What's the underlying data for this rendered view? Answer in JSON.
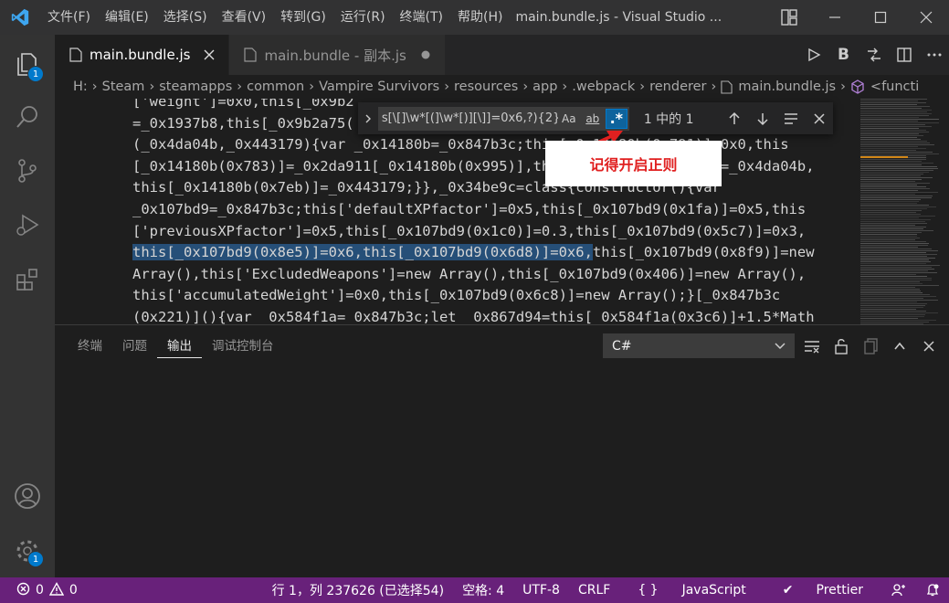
{
  "app": {
    "window_title": "main.bundle.js - Visual Studio ...",
    "menu": [
      "文件(F)",
      "编辑(E)",
      "选择(S)",
      "查看(V)",
      "转到(G)",
      "运行(R)",
      "终端(T)",
      "帮助(H)"
    ]
  },
  "activity": {
    "explorer_badge": "1",
    "settings_badge": "1"
  },
  "tabs": [
    {
      "label": "main.bundle.js",
      "active": true
    },
    {
      "label": "main.bundle - 副本.js",
      "active": false
    }
  ],
  "editor_actions": {
    "run": "▷",
    "b": "B"
  },
  "breadcrumb": [
    "H:",
    "Steam",
    "steamapps",
    "common",
    "Vampire Survivors",
    "resources",
    "app",
    ".webpack",
    "renderer",
    "main.bundle.js",
    "<functi"
  ],
  "code_lines": [
    "['weight']=0x0,this[_0x9b2",
    "=_0x1937b8,this[_0x9b2a75(",
    "(_0x4da04b,_0x443179){var _0x14180b=_0x847b3c;this[_0x14180b(0x791)]=0x0,this",
    "[_0x14180b(0x783)]=_0x2da911[_0x14180b(0x995)],this[_0x14180b(0x9a8)]=_0x4da04b,",
    "this[_0x14180b(0x7eb)]=_0x443179;}},_0x34be9c=class{constructor(){var",
    "_0x107bd9=_0x847b3c;this['defaultXPfactor']=0x5,this[_0x107bd9(0x1fa)]=0x5,this",
    "['previousXPfactor']=0x5,this[_0x107bd9(0x1c0)]=0.3,this[_0x107bd9(0x5c7)]=0x3,",
    "this[_0x107bd9(0x8f9)]=new",
    "Array(),this['ExcludedWeapons']=new Array(),this[_0x107bd9(0x406)]=new Array(),",
    "this['accumulatedWeight']=0x0,this[_0x107bd9(0x6c8)]=new Array();}[_0x847b3c",
    "(0x221)](){var _0x584f1a=_0x847b3c;let _0x867d94=this[_0x584f1a(0x3c6)]+1.5*Math"
  ],
  "code_highlight": "this[_0x107bd9(0x8e5)]=0x6,this[_0x107bd9(0x6d8)]=0x6,",
  "find": {
    "query": "s[\\[]\\w*[(]\\w*[)][\\]]=0x6,?){2}",
    "opt_case": "Aa",
    "opt_word": "ab",
    "opt_regex": ".*",
    "count": "1 中的 1"
  },
  "annotation": "记得开启正则",
  "panel": {
    "tabs": [
      "终端",
      "问题",
      "输出",
      "调试控制台"
    ],
    "active_tab": "输出",
    "output_channel": "C#"
  },
  "status": {
    "errors": "0",
    "warnings": "0",
    "position": "行 1，列 237626 (已选择54)",
    "spaces": "空格: 4",
    "encoding": "UTF-8",
    "eol": "CRLF",
    "language": "JavaScript",
    "prettier": "Prettier"
  }
}
